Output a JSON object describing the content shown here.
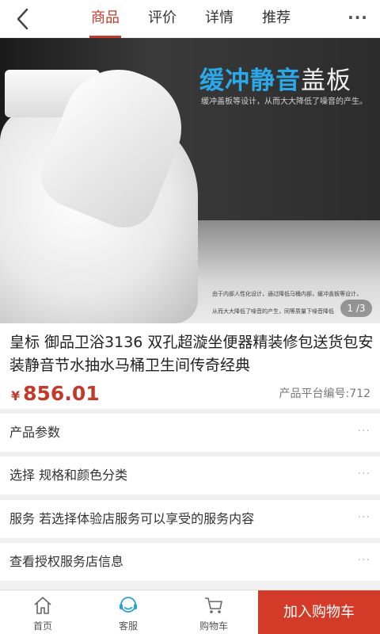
{
  "header": {
    "tabs": [
      {
        "label": "商品",
        "active": true
      },
      {
        "label": "评价",
        "active": false
      },
      {
        "label": "详情",
        "active": false
      },
      {
        "label": "推荐",
        "active": false
      }
    ],
    "more": "···"
  },
  "hero": {
    "title_blue": "缓冲静音",
    "title_white": "盖板",
    "subtitle": "缓冲盖板等设计，从而大大降低了噪音的产生。",
    "note1": "由于内部人性化设计，通过降低马桶内部，缓冲盖板等设计，",
    "note2": "从而大大降低了噪音的产生，同等质量下噪音降低",
    "pager": "1 /3"
  },
  "product": {
    "title": "皇标 御品卫浴3136 双孔超漩坐便器精装修包送货包安装静音节水抽水马桶卫生间传奇经典",
    "currency": "¥",
    "price": "856.01",
    "code": "产品平台编号:712"
  },
  "rows": [
    {
      "label": "产品参数"
    },
    {
      "label": "选择 规格和颜色分类"
    },
    {
      "label": "服务 若选择体验店服务可以享受的服务内容"
    },
    {
      "label": "查看授权服务店信息"
    }
  ],
  "row_more": "···",
  "bottom_nav": {
    "home": "首页",
    "service": "客服",
    "cart": "购物车",
    "add_to_cart": "加入购物车"
  },
  "colors": {
    "accent": "#c33a2b",
    "cart_button": "#d43a28",
    "hero_title_blue": "#2aa8e8"
  }
}
